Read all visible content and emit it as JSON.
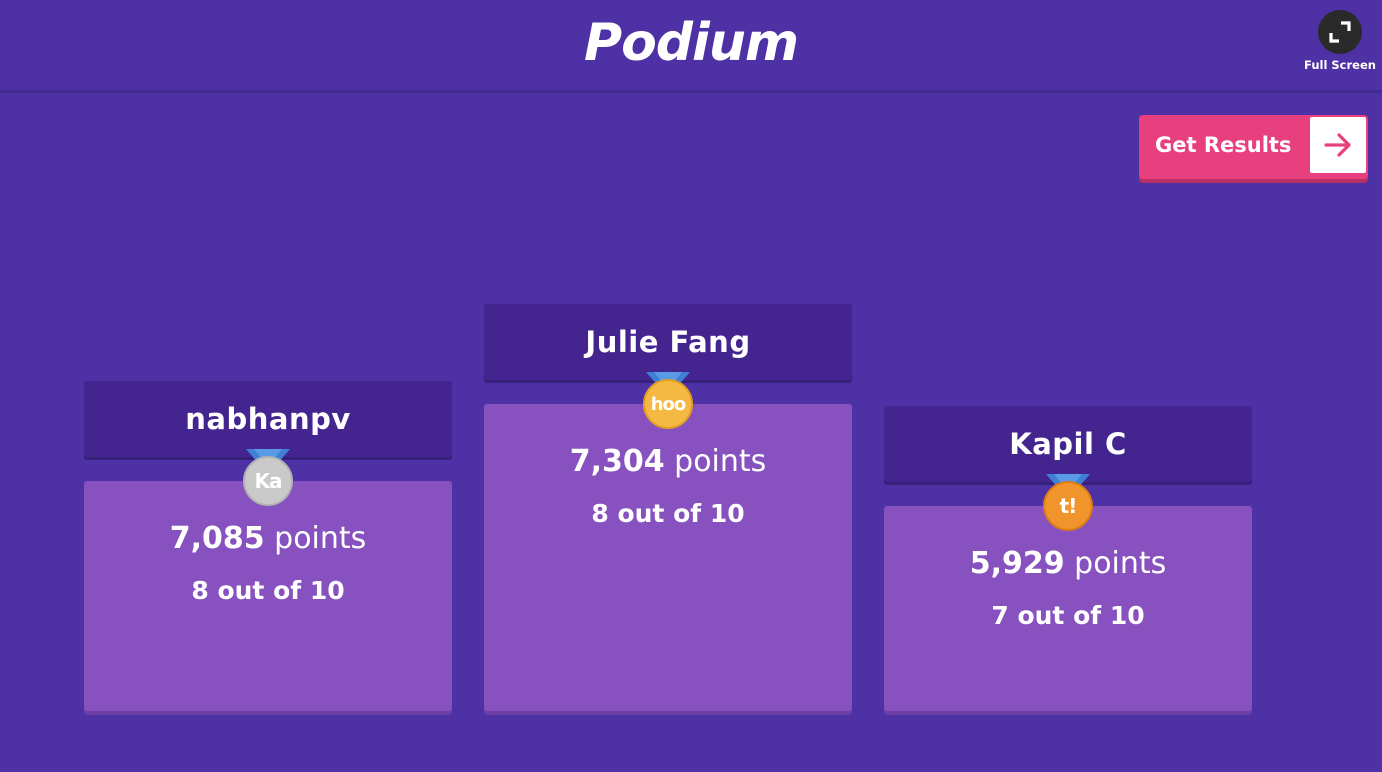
{
  "header": {
    "title": "Podium"
  },
  "fullscreen": {
    "label": "Full Screen"
  },
  "results_button": {
    "label": "Get Results"
  },
  "podium": [
    {
      "place": 2,
      "name": "nabhanpv",
      "points": "7,085",
      "points_unit": "points",
      "score": "8 out of 10",
      "medal_text": "Ka",
      "medal_color": "#c9c9c9"
    },
    {
      "place": 1,
      "name": "Julie Fang",
      "points": "7,304",
      "points_unit": "points",
      "score": "8 out of 10",
      "medal_text": "hoo",
      "medal_color": "#f4b942"
    },
    {
      "place": 3,
      "name": "Kapil C",
      "points": "5,929",
      "points_unit": "points",
      "score": "7 out of 10",
      "medal_text": "t!",
      "medal_color": "#f0952c"
    }
  ],
  "colors": {
    "background": "#4f31a6",
    "name_bar": "#44258f",
    "podium_box": "#8752bf",
    "accent": "#e8407e",
    "ribbon": "#3f7fd6"
  }
}
